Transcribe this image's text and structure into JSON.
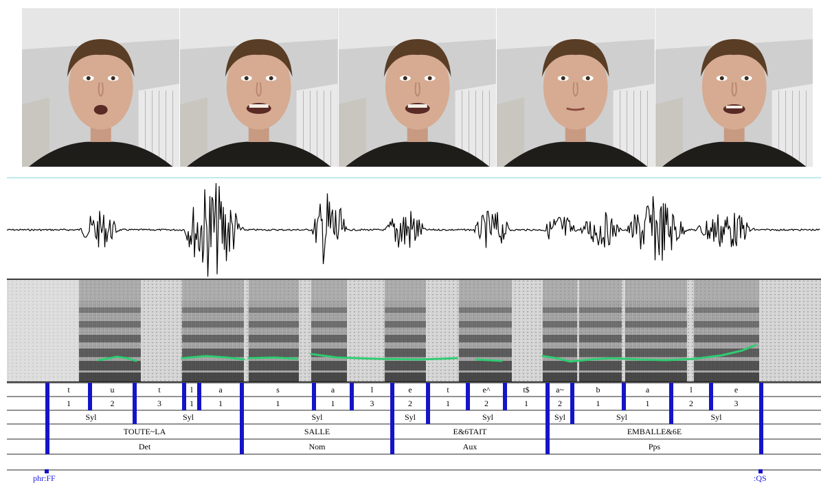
{
  "video_frames": [
    {
      "mouth": "rounded"
    },
    {
      "mouth": "open-teeth"
    },
    {
      "mouth": "open-teeth"
    },
    {
      "mouth": "closed"
    },
    {
      "mouth": "open"
    }
  ],
  "colors": {
    "boundary": "#1414c8",
    "label": "#1a1adf",
    "pitch": "#2ecc71",
    "wave": "#000000",
    "divider": "#7fd4d4"
  },
  "tiers": {
    "phonemes": [
      "t",
      "u",
      "t",
      "l",
      "a",
      "s",
      "a",
      "l",
      "e",
      "t",
      "e^",
      "t$",
      "a~",
      "b",
      "a",
      "l",
      "e"
    ],
    "phoneme_positions": [
      "1",
      "2",
      "3",
      "1",
      "1",
      "1",
      "1",
      "3",
      "2",
      "1",
      "2",
      "1",
      "2",
      "1",
      "1",
      "2",
      "3"
    ],
    "syllables": [
      "Syl",
      "Syl",
      "Syl",
      "Syl",
      "Syl",
      "Syl",
      "Syl",
      "Syl"
    ],
    "words": [
      "TOUTE~LA",
      "SALLE",
      "E&6TAIT",
      "EMBALLE&6E"
    ],
    "pos": [
      "Det",
      "Nom",
      "Aux",
      "Pps"
    ],
    "phrase_start": "phr:FF",
    "phrase_end": ":QS"
  }
}
